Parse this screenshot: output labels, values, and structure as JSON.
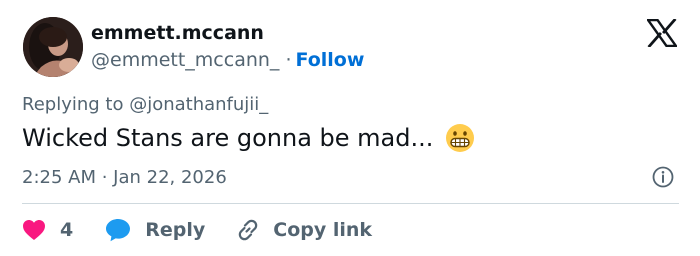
{
  "author": {
    "name": "emmett.mccann",
    "handle": "@emmett_mccann_",
    "separator": "·",
    "follow_label": "Follow",
    "avatar_icon": "profile-photo"
  },
  "brand": {
    "logo_icon": "x-logo"
  },
  "tweet": {
    "replying_to": "Replying to @jonathanfujii_",
    "text": "Wicked Stans are gonna be mad...",
    "emoji_icon": "grimacing-face-emoji",
    "timestamp": "2:25 AM · Jan 22, 2026",
    "info_icon": "info-circle-icon"
  },
  "actions": {
    "like_count": "4",
    "like_icon": "heart-icon",
    "reply_label": "Reply",
    "reply_icon": "speech-bubble-icon",
    "copy_label": "Copy link",
    "copy_icon": "link-icon"
  },
  "colors": {
    "text_primary": "#0f1419",
    "text_secondary": "#536471",
    "accent_blue": "#006fd6",
    "heart": "#f91880",
    "reply_bubble": "#1d9bf0",
    "divider": "#cfd9de"
  }
}
